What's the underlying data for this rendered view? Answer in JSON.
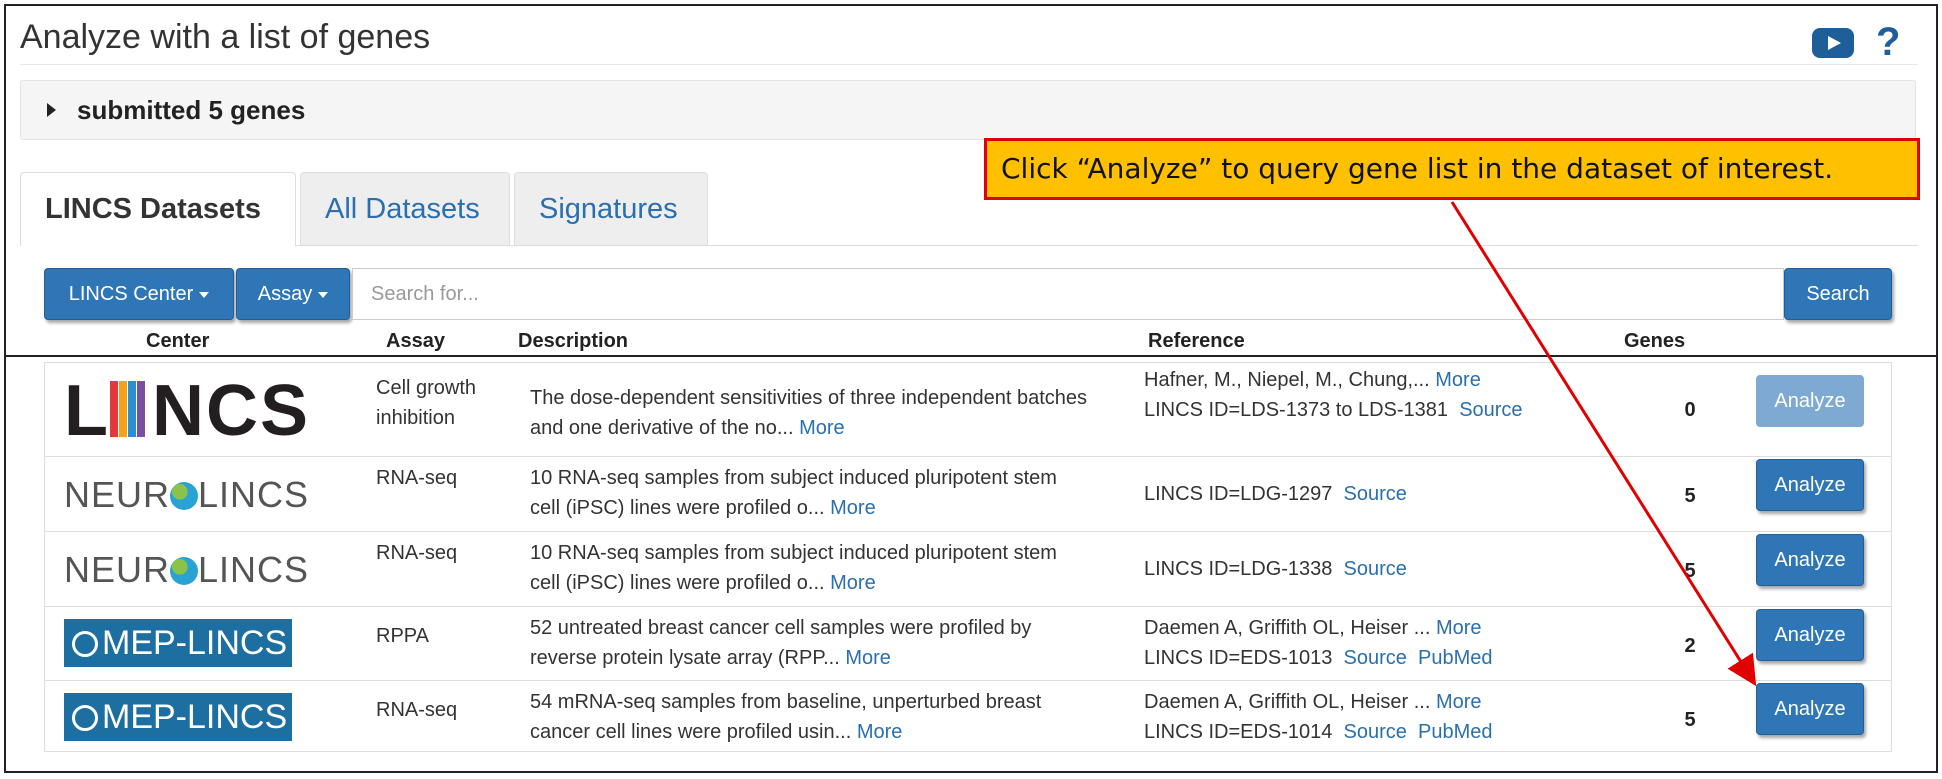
{
  "header": {
    "title": "Analyze with a list of genes",
    "video_icon": "youtube-play-icon",
    "help_icon": "question-mark-icon",
    "help_glyph": "?"
  },
  "submitted_panel": {
    "label": "submitted 5 genes",
    "icon": "caret-right-icon"
  },
  "tabs": [
    {
      "label": "LINCS Datasets",
      "active": true
    },
    {
      "label": "All Datasets",
      "active": false
    },
    {
      "label": "Signatures",
      "active": false
    }
  ],
  "filters": {
    "lincs_center_label": "LINCS Center",
    "assay_label": "Assay",
    "search_placeholder": "Search for...",
    "search_value": "",
    "search_button": "Search"
  },
  "table": {
    "columns": [
      "Center",
      "Assay",
      "Description",
      "Reference",
      "Genes"
    ],
    "rows": [
      {
        "center_logo": "LINCS",
        "assay": "Cell growth inhibition",
        "description": "The dose-dependent sensitivities of three independent batches and one derivative of the no...",
        "description_more": "More",
        "reference_line1": "Hafner, M., Niepel, M., Chung,...",
        "reference_line1_more": "More",
        "reference_line2": "LINCS ID=LDS-1373 to LDS-1381",
        "links": [
          "Source"
        ],
        "genes": "0",
        "action": "Analyze",
        "action_enabled": false
      },
      {
        "center_logo": "NEUROLINCS",
        "assay": "RNA-seq",
        "description": "10 RNA-seq samples from subject induced pluripotent stem cell (iPSC) lines were profiled o...",
        "description_more": "More",
        "reference_line1": "",
        "reference_line1_more": "",
        "reference_line2": "LINCS ID=LDG-1297",
        "links": [
          "Source"
        ],
        "genes": "5",
        "action": "Analyze",
        "action_enabled": true
      },
      {
        "center_logo": "NEUROLINCS",
        "assay": "RNA-seq",
        "description": "10 RNA-seq samples from subject induced pluripotent stem cell (iPSC) lines were profiled o...",
        "description_more": "More",
        "reference_line1": "",
        "reference_line1_more": "",
        "reference_line2": "LINCS ID=LDG-1338",
        "links": [
          "Source"
        ],
        "genes": "5",
        "action": "Analyze",
        "action_enabled": true
      },
      {
        "center_logo": "MEP-LINCS",
        "assay": "RPPA",
        "description": "52 untreated breast cancer cell samples were profiled by reverse protein lysate array (RPP...",
        "description_more": "More",
        "reference_line1": "Daemen A, Griffith OL, Heiser ...",
        "reference_line1_more": "More",
        "reference_line2": "LINCS ID=EDS-1013",
        "links": [
          "Source",
          "PubMed"
        ],
        "genes": "2",
        "action": "Analyze",
        "action_enabled": true
      },
      {
        "center_logo": "MEP-LINCS",
        "assay": "RNA-seq",
        "description": "54 mRNA-seq samples from baseline, unperturbed breast cancer cell lines were profiled usin...",
        "description_more": "More",
        "reference_line1": "Daemen A, Griffith OL, Heiser ...",
        "reference_line1_more": "More",
        "reference_line2": "LINCS ID=EDS-1014",
        "links": [
          "Source",
          "PubMed"
        ],
        "genes": "5",
        "action": "Analyze",
        "action_enabled": true
      }
    ]
  },
  "callout": {
    "text": "Click “Analyze” to query gene list in the dataset of interest.",
    "background": "#ffc000",
    "border": "#e00000"
  },
  "logos": {
    "lincs_left": "L",
    "lincs_right": "NCS",
    "neuro_left": "NEUR",
    "neuro_right": "LINCS",
    "mep_text": "MEP-LINCS"
  },
  "colors": {
    "primary_button": "#2f76b7",
    "disabled_button": "#7ea9d3",
    "link": "#2a6fae",
    "mep_logo_bg": "#1e6fa1"
  }
}
